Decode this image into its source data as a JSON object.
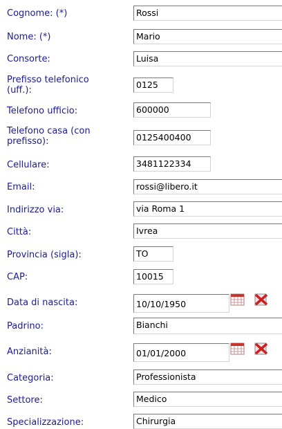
{
  "form": {
    "fields": [
      {
        "label": "Cognome: (*)",
        "value": "Rossi"
      },
      {
        "label": "Nome: (*)",
        "value": "Mario"
      },
      {
        "label": "Consorte:",
        "value": "Luisa"
      },
      {
        "label": "Prefisso telefonico (uff.):",
        "value": "0125"
      },
      {
        "label": "Telefono ufficio:",
        "value": "600000"
      },
      {
        "label": "Telefono casa (con prefisso):",
        "value": "0125400400"
      },
      {
        "label": "Cellulare:",
        "value": "3481122334"
      },
      {
        "label": "Email:",
        "value": "rossi@libero.it"
      },
      {
        "label": "Indirizzo via:",
        "value": "via Roma 1"
      },
      {
        "label": "Città:",
        "value": "Ivrea"
      },
      {
        "label": "Provincia (sigla):",
        "value": "TO"
      },
      {
        "label": "CAP:",
        "value": "10015"
      },
      {
        "label": "Data di nascita:",
        "value": "10/10/1950"
      },
      {
        "label": "Padrino:",
        "value": "Bianchi"
      },
      {
        "label": "Anzianità:",
        "value": "01/01/2000"
      },
      {
        "label": "Categoria:",
        "value": "Professionista"
      },
      {
        "label": "Settore:",
        "value": "Medico"
      },
      {
        "label": "Specializzazione:",
        "value": "Chirurgia"
      }
    ]
  },
  "icons": {
    "calendar": "calendar-icon",
    "clear": "clear-date-icon"
  },
  "colors": {
    "label": "#1a1a9c",
    "calendar_red": "#c8342e",
    "delete_red": "#cc1f1f"
  }
}
